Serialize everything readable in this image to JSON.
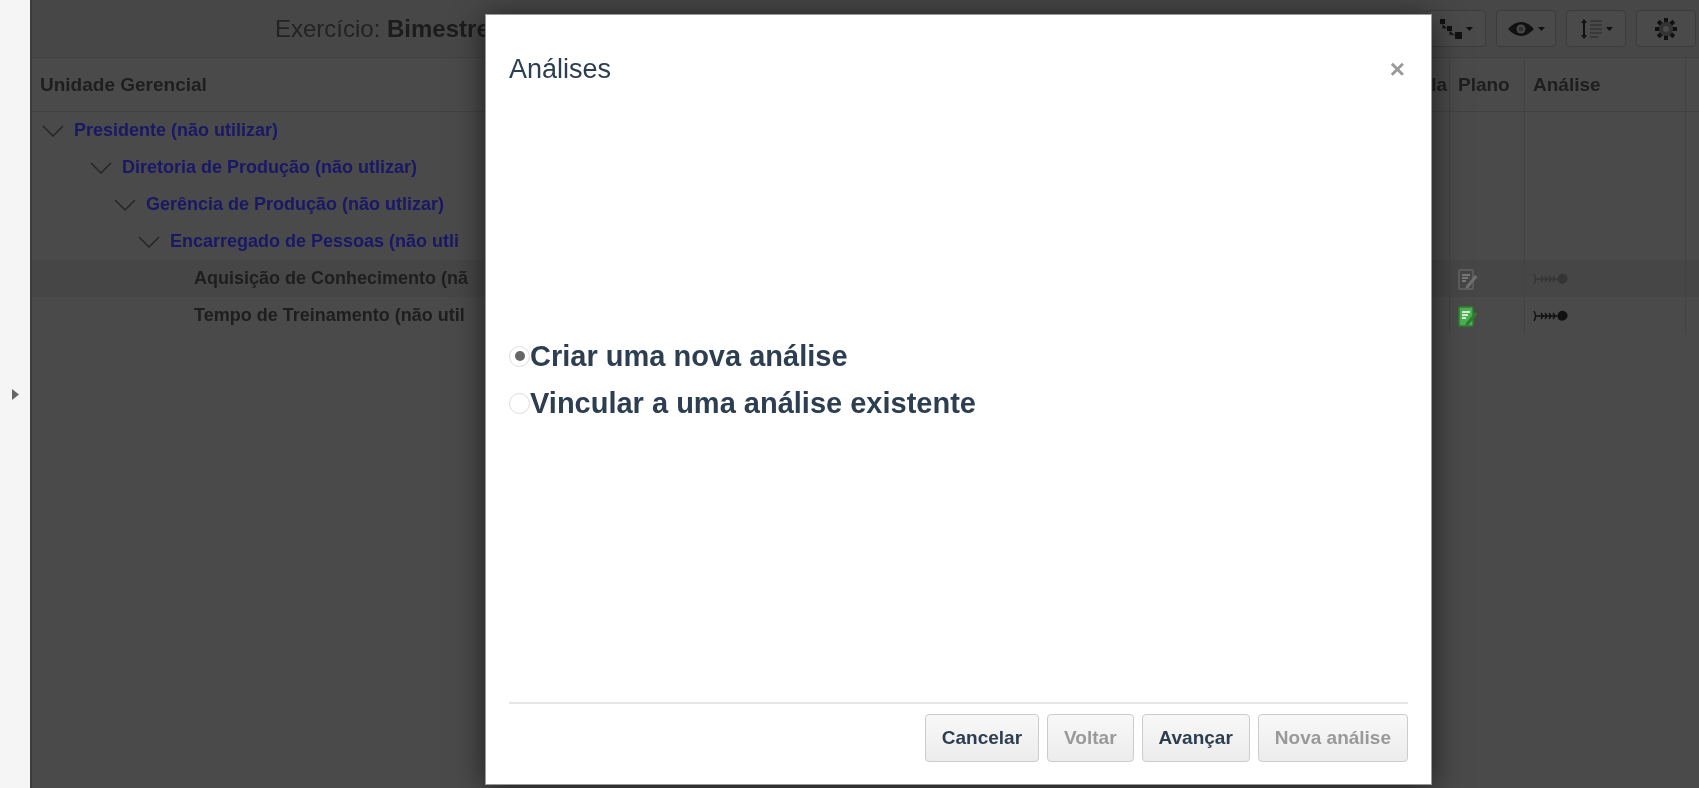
{
  "header": {
    "exercise": "Exercício: **Bimestre**"
  },
  "toolbar": [
    {
      "kind": "hierarchy",
      "dropdown": true
    },
    {
      "kind": "eye",
      "dropdown": true
    },
    {
      "kind": "line-height",
      "dropdown": true
    },
    {
      "kind": "settings",
      "dropdown": false
    }
  ],
  "table": {
    "columns": [
      "Unidade Gerencial",
      "la",
      "Plano",
      "Análise"
    ],
    "rows": [
      {
        "label": "Presidente (não utilizar)",
        "expanded": true,
        "children": [
          {
            "label": "Diretoria de Produção (não utlizar)",
            "expanded": true,
            "children": [
              {
                "label": "Gerência de Produção (não utlizar)",
                "expanded": true,
                "children": [
                  {
                    "label": "Encarregado de Pessoas (não utli",
                    "expanded": true,
                    "children": [
                      {
                        "label": "Aquisição de Conhecimento (nã",
                        "selected": true,
                        "plan_enabled": false
                      },
                      {
                        "label": "Tempo de Treinamento (não util",
                        "selected": false,
                        "plan_enabled": true
                      }
                    ]
                  }
                ]
              }
            ]
          }
        ]
      }
    ]
  },
  "modal": {
    "title": "Análises",
    "close": "×",
    "options": [
      {
        "label": "Criar uma nova análise",
        "selected": true
      },
      {
        "label": "Vincular a uma análise existente",
        "selected": false
      }
    ],
    "buttons": [
      {
        "label": "Cancelar",
        "disabled": false
      },
      {
        "label": "Voltar",
        "disabled": true
      },
      {
        "label": "Avançar",
        "disabled": false
      },
      {
        "label": "Nova análise",
        "disabled": true
      }
    ]
  }
}
